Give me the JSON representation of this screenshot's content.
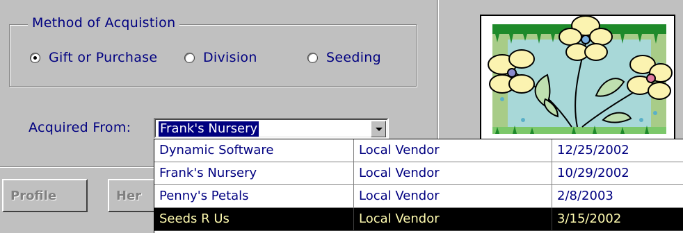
{
  "method_group": {
    "legend": "Method of Acquistion",
    "options": [
      {
        "label": "Gift or Purchase",
        "checked": true
      },
      {
        "label": "Division",
        "checked": false
      },
      {
        "label": "Seeding",
        "checked": false
      }
    ]
  },
  "acquired_from": {
    "label": "Acquired From:",
    "value": "Frank's Nursery"
  },
  "vendors": [
    {
      "name": "Dynamic Software",
      "type": "Local Vendor",
      "date": "12/25/2002",
      "selected": false
    },
    {
      "name": "Frank's Nursery",
      "type": "Local Vendor",
      "date": "10/29/2002",
      "selected": false
    },
    {
      "name": "Penny's Petals",
      "type": "Local Vendor",
      "date": "2/8/2003",
      "selected": false
    },
    {
      "name": "Seeds R Us",
      "type": "Local Vendor",
      "date": "3/15/2002",
      "selected": true
    }
  ],
  "buttons": {
    "profile": "Profile",
    "her": "Her"
  },
  "image": {
    "icon": "flower-clipart"
  },
  "colors": {
    "face": "#c0c0c0",
    "text": "#000080",
    "highlight": "#000080",
    "selected_row_bg": "#000000",
    "selected_row_text": "#fffbb0"
  }
}
